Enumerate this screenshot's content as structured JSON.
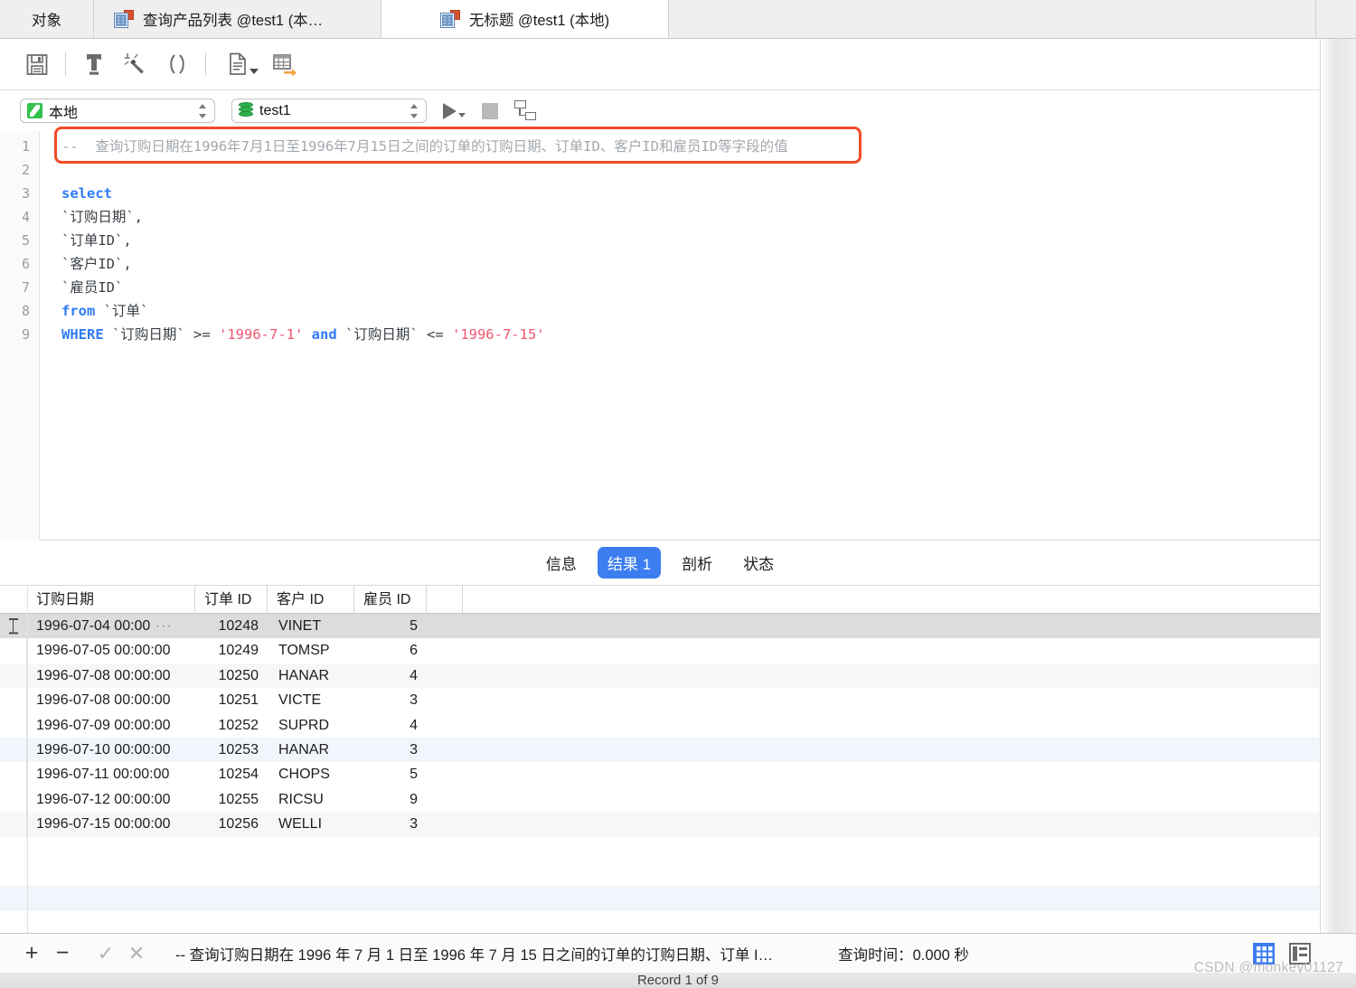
{
  "tabs": {
    "objects_label": "对象",
    "items": [
      {
        "label": "查询产品列表 @test1 (本…",
        "icon": "table-icon",
        "active": false
      },
      {
        "label": "无标题 @test1 (本地)",
        "icon": "table-icon",
        "active": true
      }
    ]
  },
  "toolbar": {
    "save_label": "保存",
    "icons": [
      "save-icon",
      "text-tool-icon",
      "beautify-wand-icon",
      "parentheses-icon",
      "document-dropdown-icon",
      "export-table-icon"
    ]
  },
  "connection": {
    "server": "本地",
    "database": "test1",
    "run_label": "运行",
    "stop_label": "停止",
    "explain_label": "解释"
  },
  "editor": {
    "lines": [
      {
        "n": "1",
        "tokens": [
          {
            "t": "cmt",
            "v": "--  查询订购日期在1996年7月1日至1996年7月15日之间的订单的订购日期、订单ID、客户ID和雇员ID等字段的值"
          }
        ]
      },
      {
        "n": "2",
        "tokens": []
      },
      {
        "n": "3",
        "tokens": [
          {
            "t": "kw",
            "v": "select"
          }
        ]
      },
      {
        "n": "4",
        "tokens": [
          {
            "t": "ident",
            "v": "`订购日期`,"
          }
        ]
      },
      {
        "n": "5",
        "tokens": [
          {
            "t": "ident",
            "v": "`订单ID`,"
          }
        ]
      },
      {
        "n": "6",
        "tokens": [
          {
            "t": "ident",
            "v": "`客户ID`,"
          }
        ]
      },
      {
        "n": "7",
        "tokens": [
          {
            "t": "ident",
            "v": "`雇员ID`"
          }
        ]
      },
      {
        "n": "8",
        "tokens": [
          {
            "t": "kw",
            "v": "from"
          },
          {
            "t": "ident",
            "v": " `订单`"
          }
        ]
      },
      {
        "n": "9",
        "tokens": [
          {
            "t": "kw",
            "v": "WHERE"
          },
          {
            "t": "ident",
            "v": " `订购日期` "
          },
          {
            "t": "op",
            "v": ">= "
          },
          {
            "t": "str",
            "v": "'1996-7-1'"
          },
          {
            "t": "kw",
            "v": " and"
          },
          {
            "t": "ident",
            "v": " `订购日期` "
          },
          {
            "t": "op",
            "v": "<= "
          },
          {
            "t": "str",
            "v": "'1996-7-15'"
          }
        ]
      }
    ]
  },
  "annotation": {
    "color": "#f04b28",
    "target": "comment-line-1"
  },
  "result_tabs": [
    {
      "label": "信息",
      "active": false
    },
    {
      "label": "结果 1",
      "active": true
    },
    {
      "label": "剖析",
      "active": false
    },
    {
      "label": "状态",
      "active": false
    }
  ],
  "grid": {
    "columns": [
      "订购日期",
      "订单 ID",
      "客户 ID",
      "雇员 ID"
    ],
    "rows": [
      {
        "date": "1996-07-04 00:00",
        "truncated": true,
        "order_id": "10248",
        "customer_id": "VINET",
        "employee_id": "5",
        "state": "selected"
      },
      {
        "date": "1996-07-05 00:00:00",
        "truncated": false,
        "order_id": "10249",
        "customer_id": "TOMSP",
        "employee_id": "6",
        "state": "normal"
      },
      {
        "date": "1996-07-08 00:00:00",
        "truncated": false,
        "order_id": "10250",
        "customer_id": "HANAR",
        "employee_id": "4",
        "state": "stripe"
      },
      {
        "date": "1996-07-08 00:00:00",
        "truncated": false,
        "order_id": "10251",
        "customer_id": "VICTE",
        "employee_id": "3",
        "state": "normal"
      },
      {
        "date": "1996-07-09 00:00:00",
        "truncated": false,
        "order_id": "10252",
        "customer_id": "SUPRD",
        "employee_id": "4",
        "state": "normal"
      },
      {
        "date": "1996-07-10 00:00:00",
        "truncated": false,
        "order_id": "10253",
        "customer_id": "HANAR",
        "employee_id": "3",
        "state": "blue"
      },
      {
        "date": "1996-07-11 00:00:00",
        "truncated": false,
        "order_id": "10254",
        "customer_id": "CHOPS",
        "employee_id": "5",
        "state": "normal"
      },
      {
        "date": "1996-07-12 00:00:00",
        "truncated": false,
        "order_id": "10255",
        "customer_id": "RICSU",
        "employee_id": "9",
        "state": "normal"
      },
      {
        "date": "1996-07-15 00:00:00",
        "truncated": false,
        "order_id": "10256",
        "customer_id": "WELLI",
        "employee_id": "3",
        "state": "stripe"
      }
    ],
    "ellipsis": "···"
  },
  "bottom": {
    "add_label": "+",
    "remove_label": "−",
    "confirm_label": "✓",
    "cancel_label": "✕",
    "status_text": "-- 查询订购日期在 1996 年 7 月 1 日至 1996 年 7 月 15 日之间的订单的订购日期、订单 I…",
    "query_time": "查询时间：0.000 秒",
    "grid_view_label": "网格视图",
    "form_view_label": "表单视图"
  },
  "footer": {
    "record_text": "Record 1 of 9"
  },
  "watermark": {
    "text": "CSDN @monkey01127"
  },
  "colors": {
    "accent_blue": "#3c7df0",
    "annotation_red": "#f04b28",
    "keyword_blue": "#2f7cf6",
    "string_red": "#ef5572",
    "comment_gray": "#a3a8ad",
    "selected_row": "#dcdcdc",
    "stripe_row": "#f7f7f7",
    "hover_row": "#f2f6fc"
  }
}
